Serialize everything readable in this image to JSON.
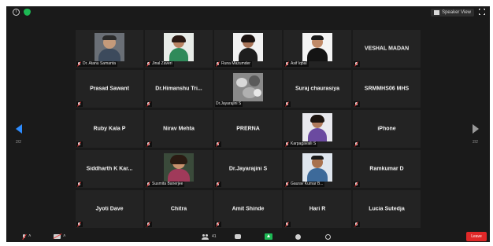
{
  "topbar": {
    "speaker_view_label": "Speaker View"
  },
  "pagination": {
    "left_page": "2/2",
    "right_page": "2/2"
  },
  "tiles": [
    {
      "name": "Dr. Atanu Samanta",
      "video": true
    },
    {
      "name": "Jinal Zaveri",
      "video": true
    },
    {
      "name": "Runa Mazumder",
      "video": true
    },
    {
      "name": "Asif Iqbal",
      "video": true
    },
    {
      "name": "VESHAL MADAN",
      "video": false
    },
    {
      "name": "Prasad Sawant",
      "video": false
    },
    {
      "name": "Dr.Himanshu Tri...",
      "video": false
    },
    {
      "name": "Dr.Jayarajini S",
      "video": true
    },
    {
      "name": "Suraj chaurasiya",
      "video": false
    },
    {
      "name": "SRMMHS06 MHS",
      "video": false
    },
    {
      "name": "Ruby Kala P",
      "video": false
    },
    {
      "name": "Nirav Mehta",
      "video": false
    },
    {
      "name": "PRERNA",
      "video": false
    },
    {
      "name": "Karpagavalli S",
      "video": true
    },
    {
      "name": "iPhone",
      "video": false
    },
    {
      "name": "Siddharth K Kar...",
      "video": false
    },
    {
      "name": "Susmita Banerjee",
      "video": true
    },
    {
      "name": "Dr.Jayarajini S",
      "video": false
    },
    {
      "name": "Gaurav Kumar B...",
      "video": true
    },
    {
      "name": "Ramkumar D",
      "video": false
    },
    {
      "name": "Jyoti Dave",
      "video": false
    },
    {
      "name": "Chitra",
      "video": false
    },
    {
      "name": "Amit Shinde",
      "video": false
    },
    {
      "name": "Hari R",
      "video": false
    },
    {
      "name": "Lucia Sutedja",
      "video": false
    }
  ],
  "toolbar": {
    "participants_count": "41",
    "leave_label": "Leave"
  },
  "colors": {
    "accent": "#2d8cff",
    "leave": "#e02828",
    "share": "#1db954",
    "tile_bg": "#232323"
  }
}
